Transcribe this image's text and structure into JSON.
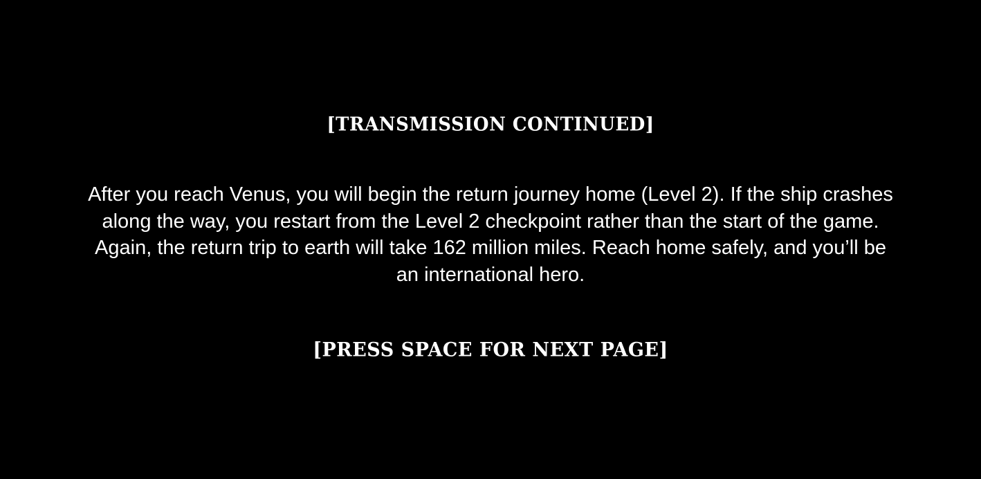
{
  "screen": {
    "background_color": "#000000",
    "text_color": "#ffffff",
    "heading": "[TRANSMISSION CONTINUED]",
    "message_lines": [
      "After you reach Venus, you will begin the return journey home (Level 2).  If the ship crashes",
      "along the way, you restart from the Level 2 checkpoint rather than the start of the game.",
      "Again, the return trip to earth will take 162 million miles.  Reach home safely, and you’ll be",
      "an international hero."
    ],
    "prompt": "[PRESS SPACE FOR NEXT PAGE]"
  }
}
